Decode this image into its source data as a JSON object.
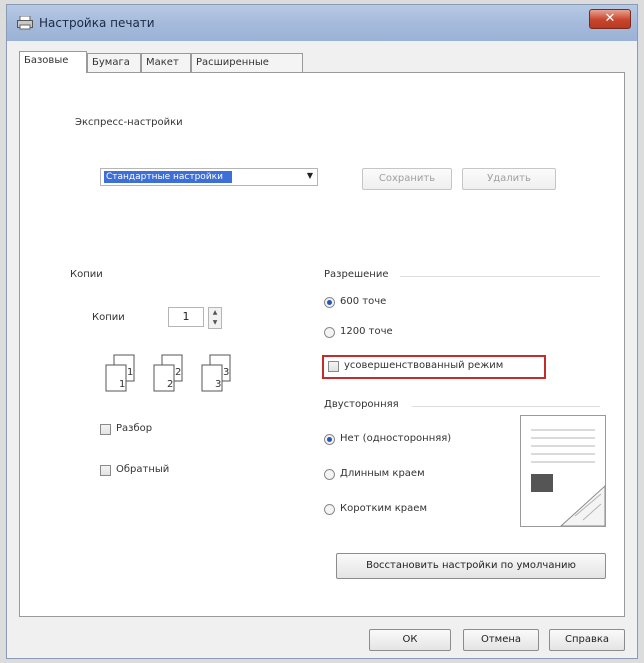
{
  "window": {
    "title": "Настройка печати",
    "close_glyph": "✕"
  },
  "tabs": [
    {
      "label": "Базовые",
      "active": true
    },
    {
      "label": "Бумага",
      "active": false
    },
    {
      "label": "Макет",
      "active": false
    },
    {
      "label": "Расширенные",
      "active": false
    }
  ],
  "express": {
    "heading": "Экспресс-настройки",
    "selected": "Стандартные настройки",
    "save_label": "Сохранить",
    "delete_label": "Удалить"
  },
  "copies": {
    "group_label": "Копии",
    "field_label": "Копии",
    "value": "1",
    "collate_label": "Разбор",
    "reverse_label": "Обратный",
    "collate_checked": false,
    "reverse_checked": false
  },
  "resolution": {
    "group_label": "Разрешение",
    "option_600": "600 точе",
    "option_1200": "1200 точе",
    "enhanced_label": "усовершенствованный режим",
    "selected": "600"
  },
  "duplex": {
    "group_label": "Двусторонняя",
    "none_label": "Нет (односторонняя)",
    "long_label": "Длинным краем",
    "short_label": "Коротким краем",
    "selected": "none"
  },
  "restore_label": "Восстановить настройки по умолчанию",
  "footer": {
    "ok_label": "ОК",
    "cancel_label": "Отмена",
    "help_label": "Справка"
  },
  "colors": {
    "accent": "#3d6fd8",
    "highlight_border": "#c42b2b",
    "titlebar": "#a7bcdc"
  }
}
